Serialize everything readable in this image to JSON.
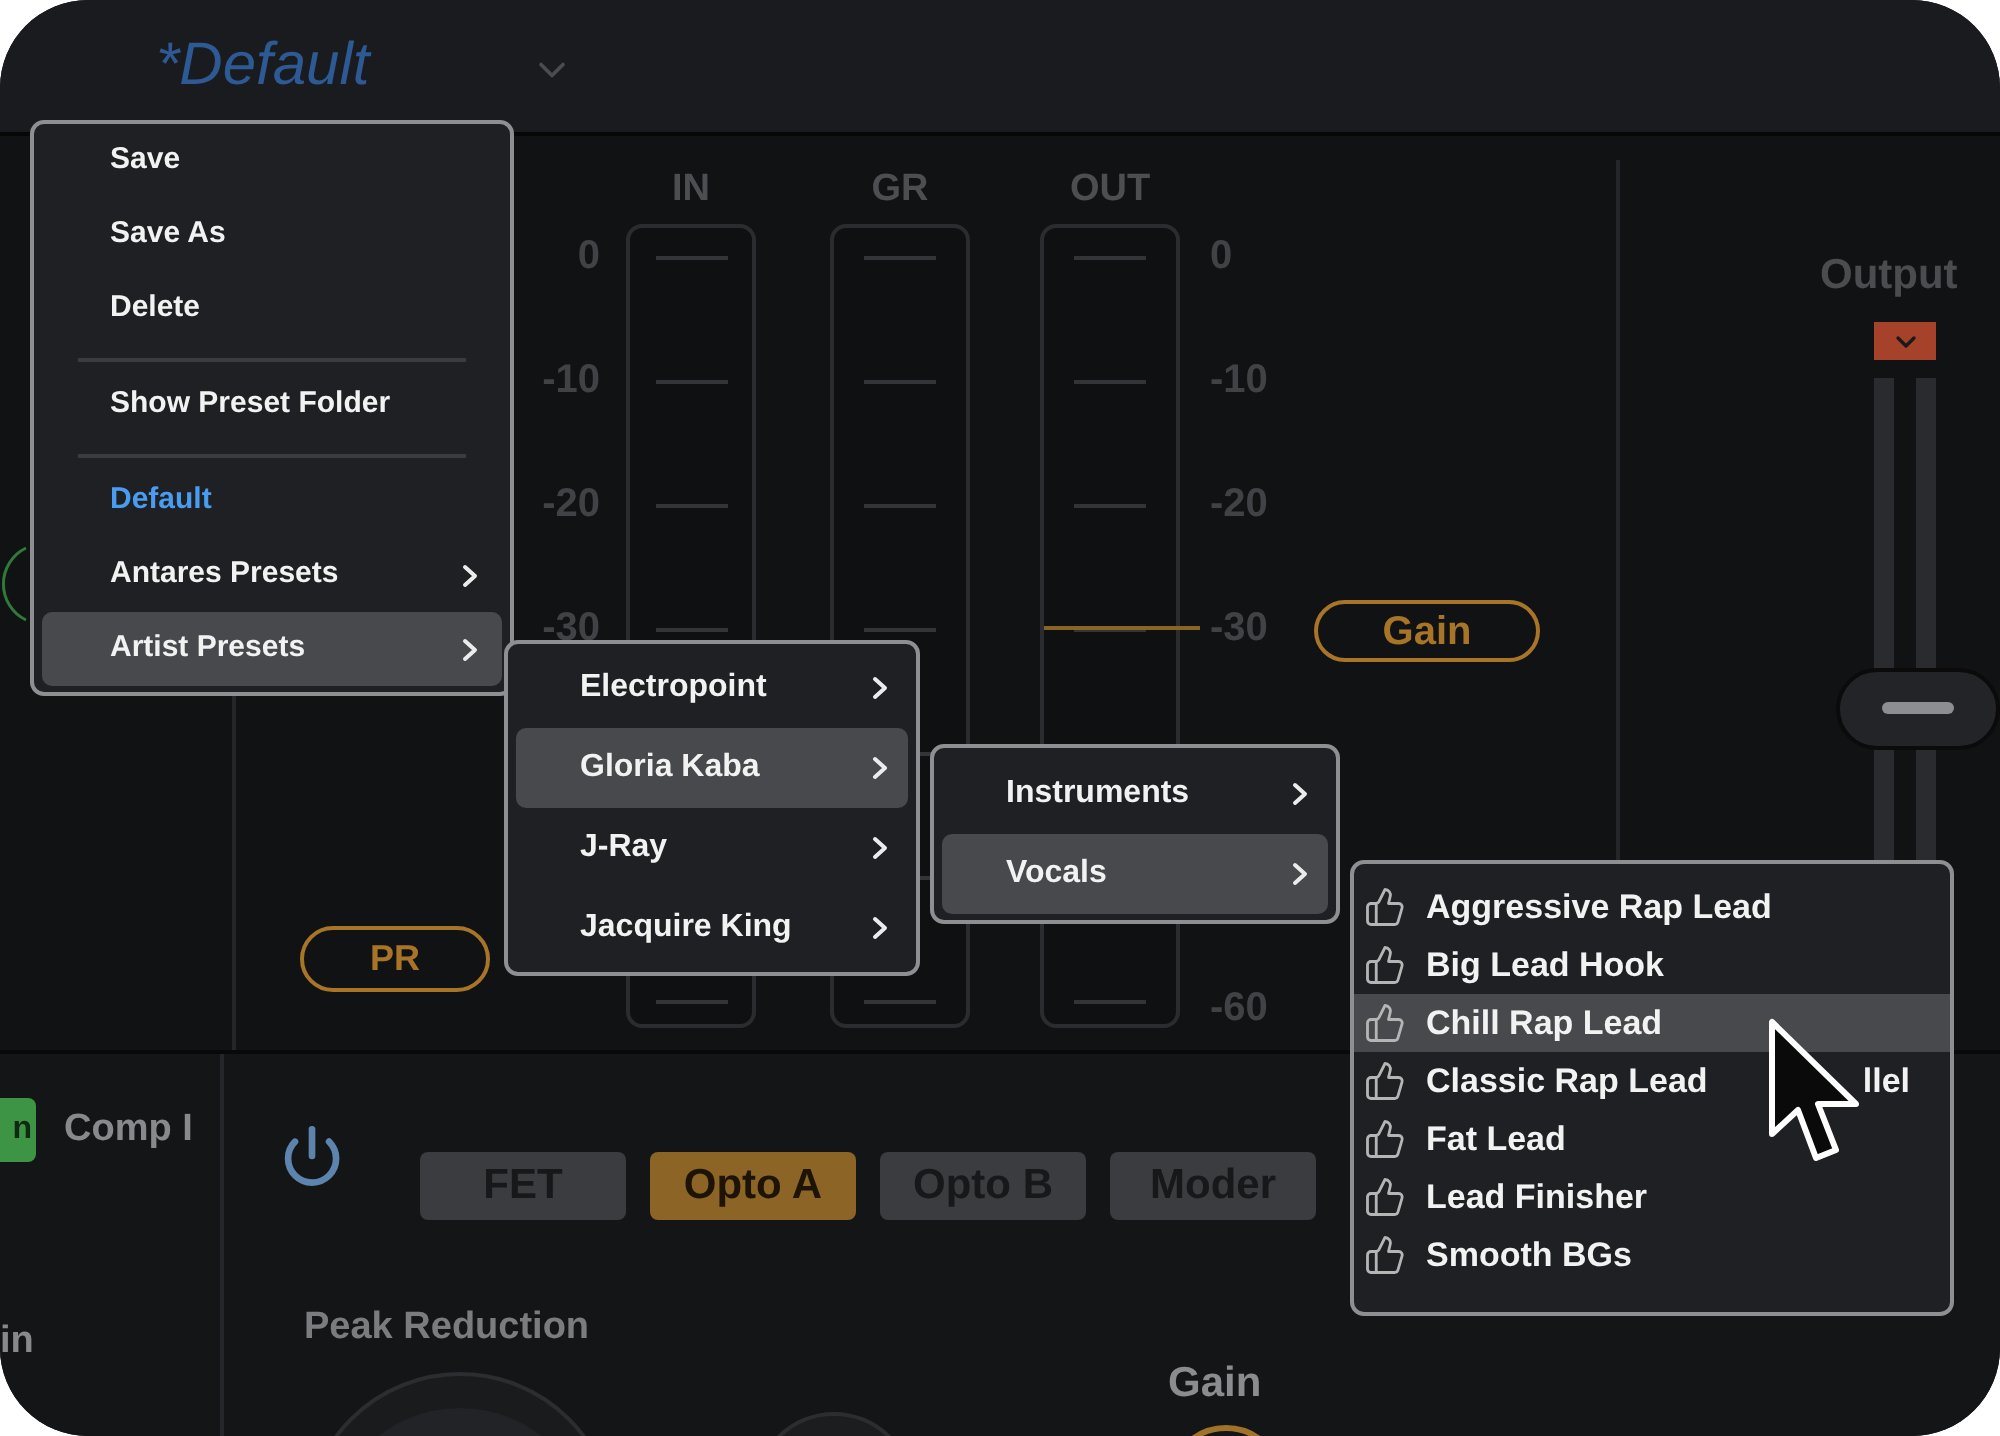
{
  "preset_bar": {
    "name": "*Default"
  },
  "menu": {
    "items": [
      {
        "kind": "action",
        "label": "Save",
        "selected": false,
        "current": false
      },
      {
        "kind": "action",
        "label": "Save As",
        "selected": false,
        "current": false
      },
      {
        "kind": "action",
        "label": "Delete",
        "selected": false,
        "current": false
      },
      {
        "kind": "divider"
      },
      {
        "kind": "action",
        "label": "Show Preset Folder",
        "selected": false,
        "current": false
      },
      {
        "kind": "divider"
      },
      {
        "kind": "preset",
        "label": "Default",
        "selected": false,
        "current": true
      },
      {
        "kind": "submenu",
        "label": "Antares Presets",
        "selected": false,
        "current": false
      },
      {
        "kind": "submenu",
        "label": "Artist Presets",
        "selected": true,
        "current": false
      }
    ]
  },
  "meters": {
    "columns": [
      {
        "label": "IN"
      },
      {
        "label": "GR"
      },
      {
        "label": "OUT"
      }
    ],
    "left_scale": [
      "0",
      "-10",
      "-20",
      "-30"
    ],
    "right_scale": [
      "0",
      "-10",
      "-20",
      "-30",
      "-60"
    ]
  },
  "handles": {
    "gain": "Gain",
    "pr": "PR"
  },
  "output": {
    "label": "Output",
    "fader": {
      "level": 0.5
    }
  },
  "artist_menu": {
    "items": [
      {
        "label": "Electropoint",
        "selected": false
      },
      {
        "label": "Gloria Kaba",
        "selected": true
      },
      {
        "label": "J-Ray",
        "selected": false
      },
      {
        "label": "Jacquire King",
        "selected": false
      }
    ]
  },
  "category_menu": {
    "items": [
      {
        "label": "Instruments",
        "selected": false
      },
      {
        "label": "Vocals",
        "selected": true
      }
    ]
  },
  "preset_menu": {
    "items": [
      {
        "label": "Aggressive Rap Lead",
        "selected": false
      },
      {
        "label": "Big Lead Hook",
        "selected": false
      },
      {
        "label": "Chill Rap Lead",
        "selected": true
      },
      {
        "label": "Classic Rap Lead",
        "label_end": "llel",
        "selected": false
      },
      {
        "label": "Fat Lead",
        "selected": false
      },
      {
        "label": "Lead Finisher",
        "selected": false
      },
      {
        "label": "Smooth BGs",
        "selected": false
      }
    ]
  },
  "module": {
    "side_tab": "n",
    "side_label": "Comp I",
    "side_caption": "in",
    "power": {
      "on": true
    },
    "modes": [
      {
        "label": "FET",
        "selected": false
      },
      {
        "label": "Opto A",
        "selected": true
      },
      {
        "label": "Opto B",
        "selected": false
      },
      {
        "label": "Moder",
        "selected": false
      }
    ],
    "peak_reduction_label": "Peak Reduction",
    "gain_label": "Gain"
  }
}
